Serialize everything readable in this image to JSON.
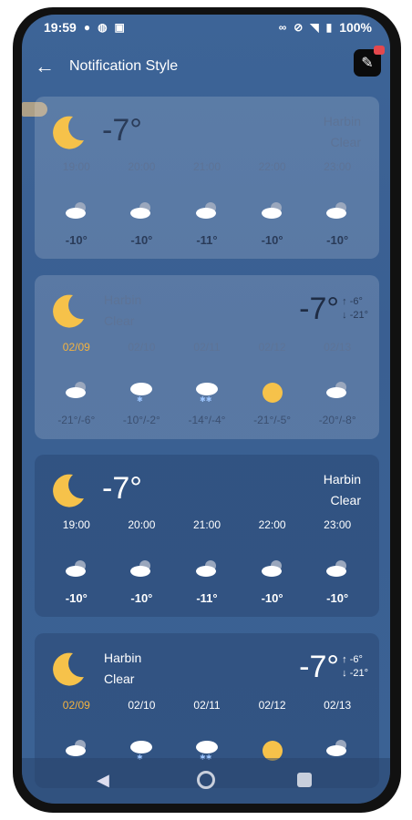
{
  "status": {
    "time": "19:59",
    "battery": "100%"
  },
  "appbar": {
    "title": "Notification Style"
  },
  "card1": {
    "temp": "-7°",
    "city": "Harbin",
    "condition": "Clear",
    "hours": [
      "19:00",
      "20:00",
      "21:00",
      "22:00",
      "23:00"
    ],
    "values": [
      "-10°",
      "-10°",
      "-11°",
      "-10°",
      "-10°"
    ]
  },
  "card2": {
    "temp": "-7°",
    "hi": "-6°",
    "lo": "-21°",
    "city": "Harbin",
    "condition": "Clear",
    "dates": [
      "02/09",
      "02/10",
      "02/11",
      "02/12",
      "02/13"
    ],
    "values": [
      "-21°/-6°",
      "-10°/-2°",
      "-14°/-4°",
      "-21°/-5°",
      "-20°/-8°"
    ],
    "icons": [
      "cloudy-night-icon",
      "snow-cloud-icon",
      "snow-cloud-icon",
      "sun-icon",
      "cloudy-night-icon"
    ]
  },
  "card3": {
    "temp": "-7°",
    "city": "Harbin",
    "condition": "Clear",
    "hours": [
      "19:00",
      "20:00",
      "21:00",
      "22:00",
      "23:00"
    ],
    "values": [
      "-10°",
      "-10°",
      "-11°",
      "-10°",
      "-10°"
    ]
  },
  "card4": {
    "temp": "-7°",
    "hi": "-6°",
    "lo": "-21°",
    "city": "Harbin",
    "condition": "Clear",
    "dates": [
      "02/09",
      "02/10",
      "02/11",
      "02/12",
      "02/13"
    ],
    "icons": [
      "cloudy-night-icon",
      "snow-cloud-icon",
      "snow-cloud-icon",
      "sun-icon",
      "cloudy-night-icon"
    ]
  },
  "colors": {
    "accent_date": "#f3b340",
    "moon": "#f6c24a",
    "background": "#3d6497"
  }
}
